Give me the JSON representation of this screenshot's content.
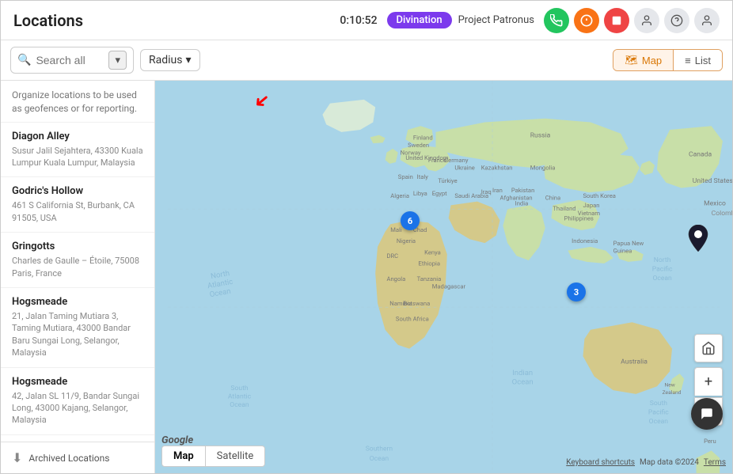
{
  "header": {
    "title": "Locations",
    "timer": "0:10:52",
    "badge_divination": "Divination",
    "project": "Project Patronus"
  },
  "toolbar": {
    "search_placeholder": "Search all",
    "radius_label": "Radius",
    "map_label": "Map",
    "list_label": "List"
  },
  "sidebar": {
    "description": "Organize locations to be used as geofences or for reporting.",
    "locations": [
      {
        "name": "Diagon Alley",
        "address": "Susur Jalil Sejahtera, 43300 Kuala Lumpur Kuala Lumpur, Malaysia"
      },
      {
        "name": "Godric's Hollow",
        "address": "461 S California St, Burbank, CA 91505, USA"
      },
      {
        "name": "Gringotts",
        "address": "Charles de Gaulle – Étoile, 75008 Paris, France"
      },
      {
        "name": "Hogsmeade",
        "address": "21, Jalan Taming Mutiara 3, Taming Mutiara, 43000 Bandar Baru Sungai Long, Selangor, Malaysia"
      },
      {
        "name": "Hogsmeade",
        "address": "42, Jalan SL 11/9, Bandar Sungai Long, 43000 Kajang, Selangor, Malaysia"
      }
    ],
    "archive_label": "Archived Locations"
  },
  "map": {
    "tab_map": "Map",
    "tab_satellite": "Satellite",
    "attribution": "Keyboard shortcuts",
    "map_data": "Map data ©2024",
    "terms": "Terms"
  },
  "icons": {
    "search": "🔍",
    "map_view": "🗺",
    "list_view": "≡",
    "archive": "📦",
    "zoom_in": "+",
    "zoom_out": "−",
    "expand": "⊞",
    "chat": "💬"
  }
}
